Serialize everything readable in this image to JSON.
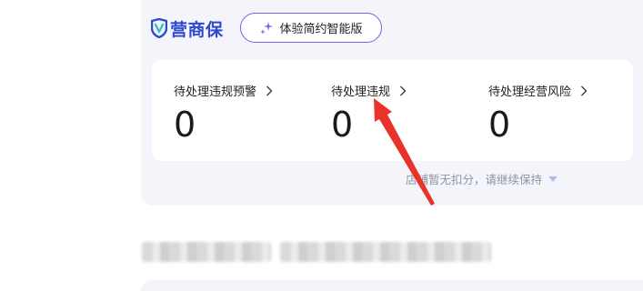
{
  "brand": {
    "name": "营商保",
    "icon": "shield-v-logo",
    "color": "#2d49cc"
  },
  "experience_button": {
    "label": "体验简约智能版",
    "icon": "sparkle-icon",
    "border_color": "#7c5fe6"
  },
  "stats": [
    {
      "label": "待处理违规预警",
      "value": "0"
    },
    {
      "label": "待处理违规",
      "value": "0"
    },
    {
      "label": "待处理经营风险",
      "value": "0"
    }
  ],
  "footnote": {
    "text": "店铺暂无扣分，请继续保持",
    "icon": "caret-down-icon"
  },
  "annotation": {
    "color": "#e8332a",
    "description_icon": "red-arrow"
  }
}
